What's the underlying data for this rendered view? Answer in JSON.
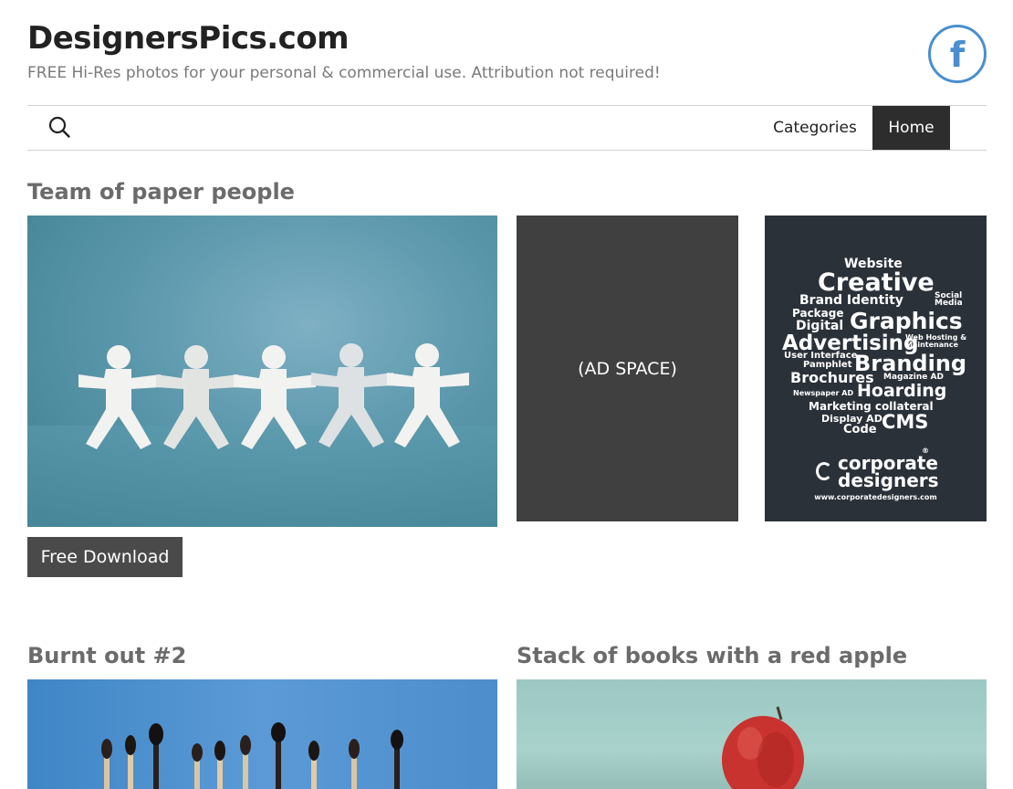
{
  "site": {
    "title": "DesignersPics.com",
    "tagline": "FREE Hi-Res photos for your personal & commercial use. Attribution not required!"
  },
  "social": {
    "icon": "facebook-icon",
    "glyph": "f"
  },
  "nav": {
    "search_icon": "search-icon",
    "items": [
      {
        "label": "Categories",
        "active": false
      },
      {
        "label": "Home",
        "active": true
      }
    ]
  },
  "posts": [
    {
      "title": "Team of paper people",
      "download_label": "Free Download"
    },
    {
      "title": "Burnt out #2"
    },
    {
      "title": "Stack of books with a red apple"
    }
  ],
  "ads": {
    "placeholder_label": "(AD SPACE)",
    "banner": {
      "words": [
        "Website",
        "Creative",
        "Social",
        "Media",
        "Brand Identity",
        "Package",
        "Digital",
        "Graphics",
        "Advertising",
        "Web Hosting &",
        "Maintenance",
        "User Interface",
        "Pamphlet",
        "Branding",
        "Brochures",
        "Magazine AD",
        "Newspaper AD",
        "Hoarding",
        "Marketing collateral",
        "Display AD",
        "Code",
        "CMS"
      ],
      "logo_line1": "corporate",
      "logo_line2": "designers",
      "registered": "®",
      "url": "www.corporatedesigners.com"
    }
  },
  "colors": {
    "nav_active_bg": "#2d2d2d",
    "facebook_blue": "#4a8fd0",
    "button_bg": "#4a4a4a",
    "ad_bg": "#404040"
  }
}
